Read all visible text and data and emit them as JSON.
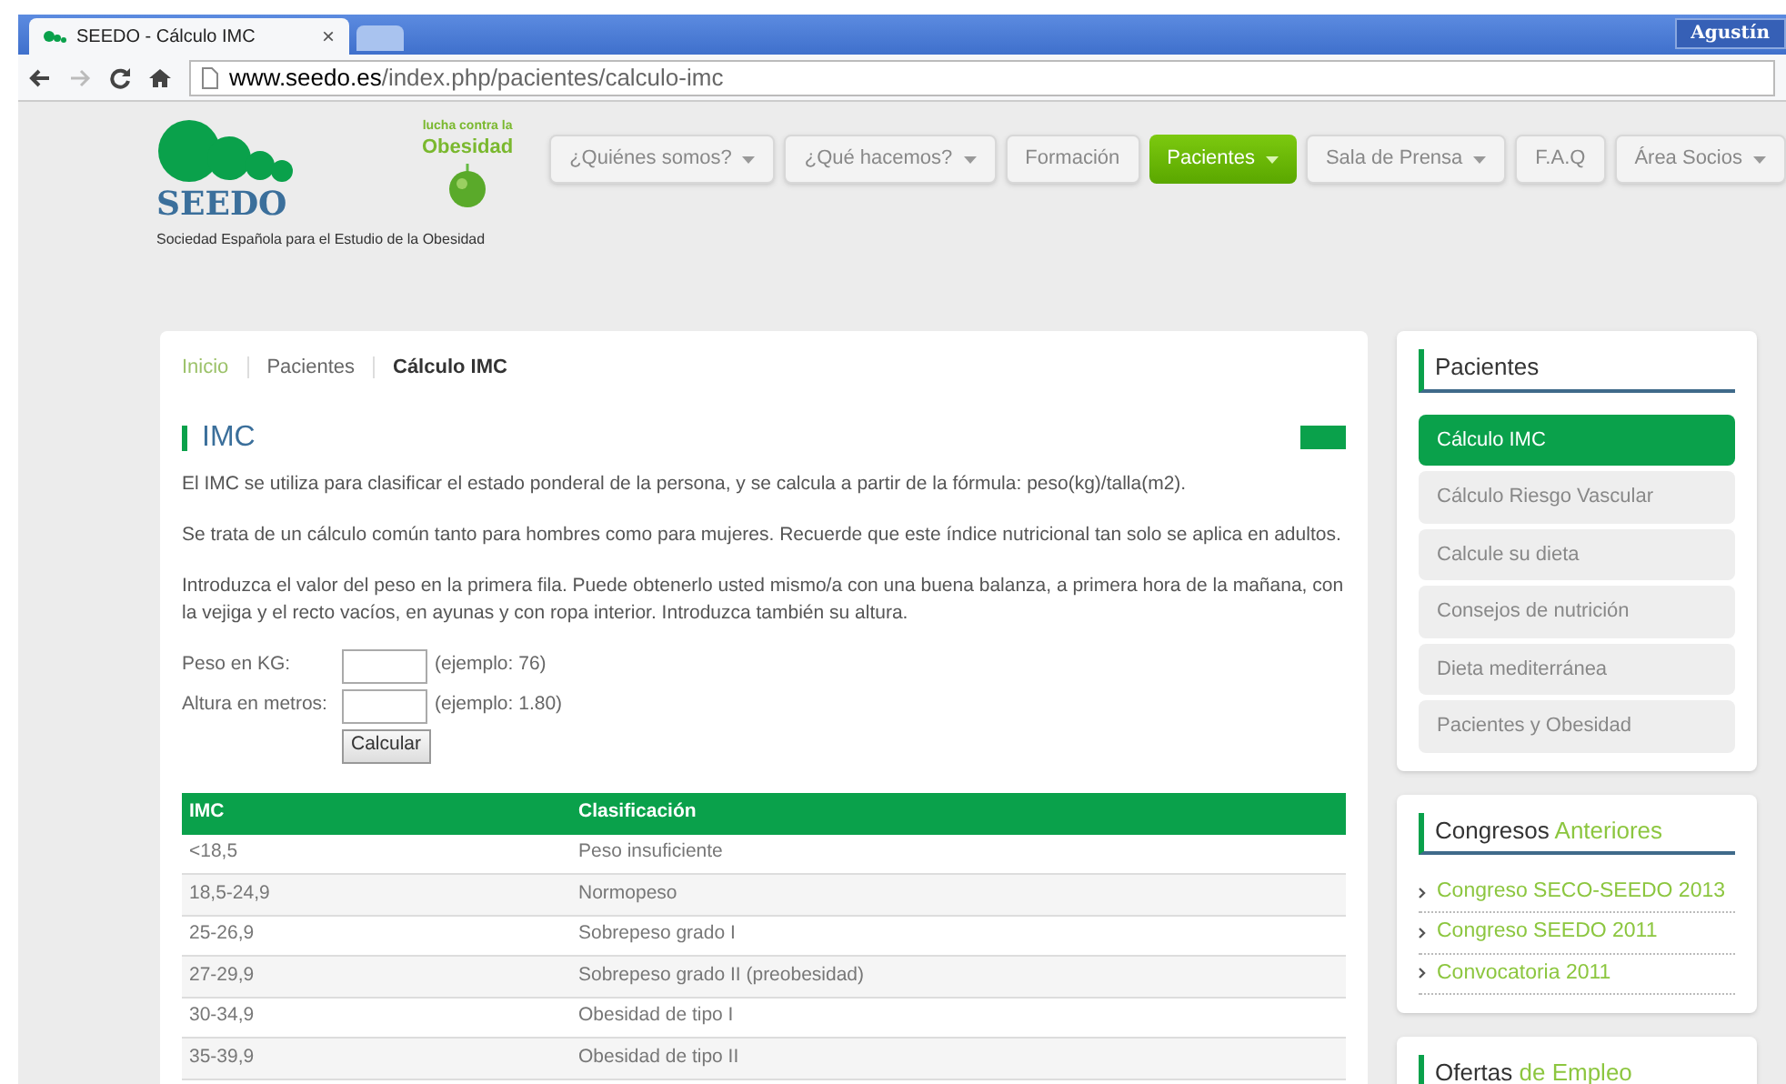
{
  "browser": {
    "tab_title": "SEEDO - Cálculo IMC",
    "tab_close": "×",
    "user": "Agustín",
    "url_host": "www.seedo.es",
    "url_path": "/index.php/pacientes/calculo-imc"
  },
  "logo": {
    "name": "SEEDO",
    "subtitle": "Sociedad Española para el Estudio de la Obesidad",
    "badge_top": "lucha contra la",
    "badge_main": "Obesidad"
  },
  "nav": [
    {
      "label": "¿Quiénes somos?",
      "dropdown": true,
      "selected": false
    },
    {
      "label": "¿Qué hacemos?",
      "dropdown": true,
      "selected": false
    },
    {
      "label": "Formación",
      "dropdown": false,
      "selected": false
    },
    {
      "label": "Pacientes",
      "dropdown": true,
      "selected": true
    },
    {
      "label": "Sala de Prensa",
      "dropdown": true,
      "selected": false
    },
    {
      "label": "F.A.Q",
      "dropdown": false,
      "selected": false
    },
    {
      "label": "Área Socios",
      "dropdown": true,
      "selected": false
    }
  ],
  "breadcrumb": [
    {
      "label": "Inicio",
      "kind": "link"
    },
    {
      "label": "Pacientes",
      "kind": "plain"
    },
    {
      "label": "Cálculo IMC",
      "kind": "current"
    }
  ],
  "heading": "IMC",
  "paragraphs": [
    "El IMC se utiliza para clasificar el estado ponderal de la persona, y se calcula a partir de la fórmula: peso(kg)/talla(m2).",
    "Se trata de un cálculo común tanto para hombres como para mujeres. Recuerde que este índice nutricional tan solo se aplica en adultos.",
    "Introduzca el valor del peso en la primera fila. Puede obtenerlo usted mismo/a con una buena balanza, a primera hora de la mañana, con la vejiga y el recto vacíos, en ayunas y con ropa interior. Introduzca también su altura."
  ],
  "form": {
    "fields": [
      {
        "label": "Peso en KG:",
        "hint": "(ejemplo: 76)"
      },
      {
        "label": "Altura en metros:",
        "hint": "(ejemplo: 1.80)"
      }
    ],
    "button": "Calcular"
  },
  "table": {
    "columns": [
      "IMC",
      "Clasificación"
    ],
    "rows": [
      [
        "<18,5",
        "Peso insuficiente"
      ],
      [
        "18,5-24,9",
        "Normopeso"
      ],
      [
        "25-26,9",
        "Sobrepeso grado I"
      ],
      [
        "27-29,9",
        "Sobrepeso grado II (preobesidad)"
      ],
      [
        "30-34,9",
        "Obesidad de tipo I"
      ],
      [
        "35-39,9",
        "Obesidad de tipo II"
      ]
    ]
  },
  "sidebar": [
    {
      "title": "Pacientes",
      "kind": "menu",
      "items": [
        {
          "label": "Cálculo IMC",
          "selected": true
        },
        {
          "label": "Cálculo Riesgo Vascular",
          "selected": false
        },
        {
          "label": "Calcule su dieta",
          "selected": false
        },
        {
          "label": "Consejos de nutrición",
          "selected": false
        },
        {
          "label": "Dieta mediterránea",
          "selected": false
        },
        {
          "label": "Pacientes y Obesidad",
          "selected": false
        }
      ]
    },
    {
      "title": "Congresos",
      "title_accent": "Anteriores",
      "kind": "links",
      "items": [
        {
          "label": "Congreso SECO-SEEDO 2013"
        },
        {
          "label": "Congreso SEEDO 2011"
        },
        {
          "label": "Convocatoria 2011"
        }
      ]
    },
    {
      "title": "Ofertas",
      "title_accent": "de Empleo",
      "kind": "links"
    }
  ]
}
